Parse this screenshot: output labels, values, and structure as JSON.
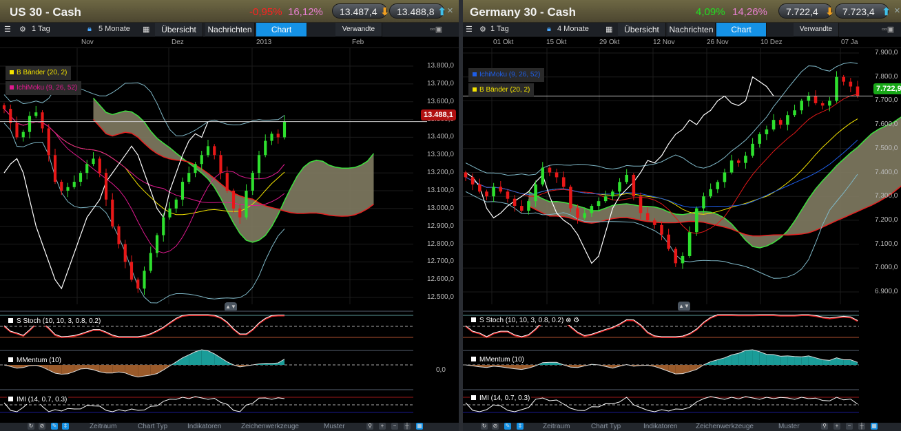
{
  "left": {
    "title": "US 30 - Cash",
    "change": "-0,95%",
    "perf": "16,12%",
    "bid": "13.487,4",
    "ask": "13.488,8",
    "toolbar": {
      "interval": "1 Tag",
      "range": "5 Monate",
      "tabs": [
        "Übersicht",
        "Nachrichten",
        "Chart",
        "Verwandte"
      ],
      "active_tab": "Chart"
    },
    "dates": [
      "Nov",
      "Dez",
      "2013",
      "Feb"
    ],
    "yaxis": [
      "13.800,0",
      "13.700,0",
      "13.600,0",
      "13.500,0",
      "13.400,0",
      "13.300,0",
      "13.200,0",
      "13.100,0",
      "13.000,0",
      "12.900,0",
      "12.800,0",
      "12.700,0",
      "12.600,0",
      "12.500,0"
    ],
    "price_tag": "13.488,1",
    "legends": [
      {
        "label": "B Bänder (20, 2)",
        "color": "#f5e400"
      },
      {
        "label": "IchiMoku (9, 26, 52)",
        "color": "#e0198f"
      }
    ],
    "indicators": [
      "S Stoch (10, 10, 3, 0.8, 0.2)",
      "MMentum (10)",
      "IMI (14, 0.7, 0.3)"
    ],
    "momentum_zero": "0,0",
    "closes": [
      13560,
      13480,
      13400,
      13430,
      13520,
      13540,
      13450,
      13300,
      13150,
      13100,
      13120,
      13150,
      13200,
      13250,
      13280,
      13200,
      13050,
      12900,
      12800,
      12700,
      12600,
      12550,
      12650,
      12750,
      12850,
      12950,
      13000,
      13050,
      13150,
      13200,
      13250,
      13300,
      13350,
      13300,
      13200,
      13100,
      13000,
      12950,
      13100,
      13200,
      13300,
      13380,
      13420,
      13400,
      13488
    ]
  },
  "right": {
    "title": "Germany 30 - Cash",
    "change": "4,09%",
    "perf": "14,26%",
    "bid": "7.722,4",
    "ask": "7.723,4",
    "toolbar": {
      "interval": "1 Tag",
      "range": "4 Monate",
      "tabs": [
        "Übersicht",
        "Nachrichten",
        "Chart",
        "Verwandte"
      ],
      "active_tab": "Chart"
    },
    "dates": [
      "01 Okt",
      "15 Okt",
      "29 Okt",
      "12 Nov",
      "26 Nov",
      "10 Dez",
      "07 Ja"
    ],
    "yaxis": [
      "7.900,0",
      "7.800,0",
      "7.700,0",
      "7.600,0",
      "7.500,0",
      "7.400,0",
      "7.300,0",
      "7.200,0",
      "7.100,0",
      "7.000,0",
      "6.900,0"
    ],
    "price_tag": "7.722,9",
    "legends": [
      {
        "label": "IchiMoku (9, 26, 52)",
        "color": "#1e5ee8"
      },
      {
        "label": "B Bänder (20, 2)",
        "color": "#f5e400"
      }
    ],
    "indicators": [
      "S Stoch (10, 10, 3, 0.8, 0.2)",
      "MMentum (10)",
      "IMI (14, 0.7, 0.3)"
    ],
    "closes": [
      7380,
      7350,
      7320,
      7300,
      7340,
      7320,
      7290,
      7260,
      7240,
      7280,
      7350,
      7420,
      7400,
      7380,
      7340,
      7250,
      7210,
      7230,
      7260,
      7280,
      7300,
      7320,
      7360,
      7390,
      7300,
      7230,
      7200,
      7180,
      7140,
      7080,
      7020,
      7050,
      7150,
      7250,
      7300,
      7330,
      7360,
      7400,
      7450,
      7440,
      7470,
      7520,
      7560,
      7580,
      7620,
      7600,
      7640,
      7660,
      7700,
      7720,
      7690,
      7680,
      7700,
      7800,
      7780,
      7760,
      7720
    ]
  },
  "bottom_toolbar": [
    "Zeitraum",
    "Chart Typ",
    "Indikatoren",
    "Zeichenwerkzeuge",
    "Muster"
  ],
  "colors": {
    "up": "#2ee02e",
    "down": "#e81818",
    "active_tab": "#1592e6",
    "negative": "#ff2020",
    "positive": "#22dd22",
    "perf": "#e77fd0"
  }
}
